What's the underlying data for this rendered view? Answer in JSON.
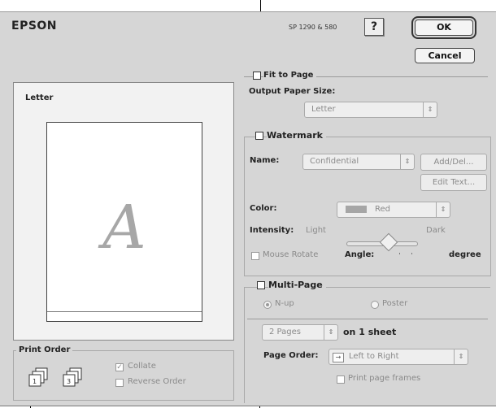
{
  "header": {
    "brand": "EPSON",
    "model": "SP 1290 & 580",
    "help_label": "?",
    "ok_label": "OK",
    "cancel_label": "Cancel"
  },
  "preview": {
    "paper_label": "Letter",
    "watermark_glyph": "A"
  },
  "print_order": {
    "title": "Print Order",
    "collate_label": "Collate",
    "collate_checked": true,
    "reverse_order_label": "Reverse Order",
    "reverse_order_checked": false
  },
  "fit_to_page": {
    "label": "Fit to Page",
    "checked": false,
    "output_paper_size_label": "Output Paper Size:",
    "output_paper_size_value": "Letter"
  },
  "watermark": {
    "label": "Watermark",
    "checked": false,
    "name_label": "Name:",
    "name_value": "Confidential",
    "add_del_label": "Add/Del...",
    "edit_text_label": "Edit Text...",
    "color_label": "Color:",
    "color_value": "Red",
    "intensity_label": "Intensity:",
    "intensity_light": "Light",
    "intensity_dark": "Dark",
    "intensity_level": 0.5,
    "mouse_rotate_label": "Mouse Rotate",
    "angle_label": "Angle:",
    "angle_unit": "degree"
  },
  "multi_page": {
    "label": "Multi-Page",
    "checked": false,
    "nup_label": "N-up",
    "poster_label": "Poster",
    "selected_mode": "N-up",
    "pages_value": "2 Pages",
    "on_sheet_label": "on 1 sheet",
    "page_order_label": "Page Order:",
    "page_order_value": "Left to Right",
    "print_page_frames_label": "Print page frames"
  },
  "colors": {
    "dialog_bg": "#d6d6d6",
    "dim_text": "#8a8a8a",
    "watermark_gray": "#a6a6a6"
  }
}
